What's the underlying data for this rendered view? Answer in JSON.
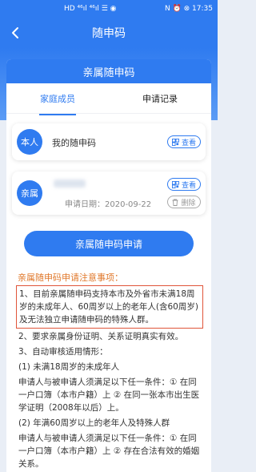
{
  "status_bar": {
    "left": "HD ⁴⁶ıl ⁴⁶ıl ☰ ◉",
    "right": "N ⏰ ⊗ 17:35"
  },
  "nav": {
    "title": "随申码"
  },
  "card": {
    "header": "亲属随申码",
    "tabs": [
      "家庭成员",
      "申请记录"
    ]
  },
  "members": [
    {
      "avatar": "本人",
      "name": "我的随申码",
      "view_label": "查看"
    },
    {
      "avatar": "亲属",
      "date": "申请日期：2020-09-22",
      "view_label": "查看",
      "delete_label": "删除"
    }
  ],
  "apply_button": "亲属随申码申请",
  "notice": {
    "title": "亲属随申码申请注意事项：",
    "highlight": "1、目前亲属随申码支持本市及外省市未满18周岁的未成年人、60周岁以上的老年人(含60周岁)及无法独立申请随申码的特殊人群。",
    "items": [
      "2、要求亲属身份证明、关系证明真实有效。",
      "3、自动审核适用情形：",
      "(1) 未满18周岁的未成年人",
      "申请人与被申请人须满足以下任一条件：① 在同一户口簿（本市户籍）上 ② 在同一张本市出生医学证明（2008年以后）上。",
      "(2) 年满60周岁以上的老年人及特殊人群",
      "申请人与被申请人须满足以下任一条件：① 在同一户口簿（本市户籍）上 ② 存在合法有效的婚姻关系。"
    ]
  }
}
